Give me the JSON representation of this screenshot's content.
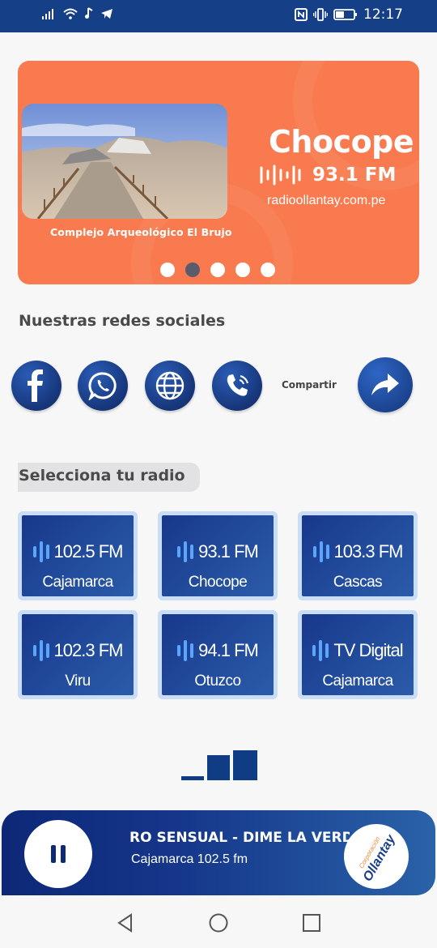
{
  "status_bar": {
    "time": "12:17"
  },
  "banner": {
    "station_name": "Chocope",
    "frequency": "93.1 FM",
    "url": "radioollantay.com.pe",
    "caption": "Complejo Arqueológico El Brujo",
    "dots_total": 5,
    "active_dot": 2,
    "color": "#f87a4e"
  },
  "social": {
    "title": "Nuestras redes sociales",
    "items": [
      {
        "icon": "facebook-icon"
      },
      {
        "icon": "whatsapp-icon"
      },
      {
        "icon": "globe-icon"
      },
      {
        "icon": "phone-icon"
      }
    ],
    "share_label": "Compartir"
  },
  "radio_section": {
    "title": "Selecciona tu radio",
    "stations": [
      {
        "line1": "102.5 FM",
        "line2": "Cajamarca"
      },
      {
        "line1": "93.1 FM",
        "line2": "Chocope"
      },
      {
        "line1": "103.3 FM",
        "line2": "Cascas"
      },
      {
        "line1": "102.3 FM",
        "line2": "Viru"
      },
      {
        "line1": "94.1 FM",
        "line2": "Otuzco"
      },
      {
        "line1": "TV Digital",
        "line2": "Cajamarca"
      }
    ]
  },
  "player": {
    "song_title": "RO SENSUAL - DIME LA VERDA",
    "station": "Cajamarca 102.5 fm",
    "logo_text_top": "Corporación",
    "logo_text_main": "Ollantay"
  },
  "colors": {
    "primary": "#153f86",
    "accent": "#f87a4e",
    "card_border": "#c9ddf6"
  }
}
